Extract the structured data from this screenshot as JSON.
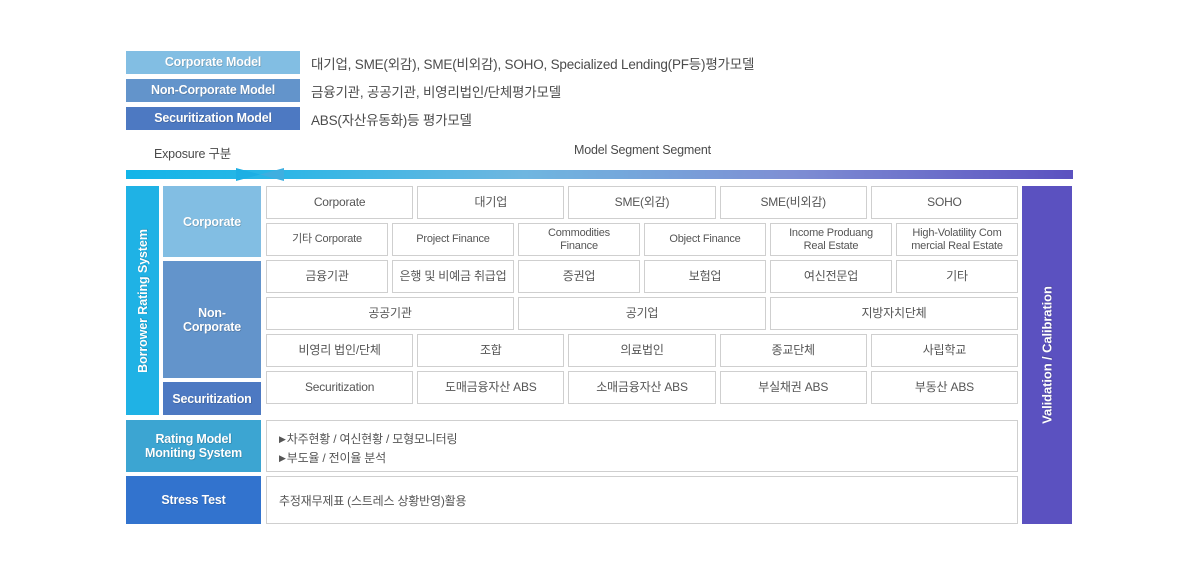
{
  "legend": {
    "rows": [
      {
        "label": "Corporate Model",
        "color": "#82BEE3",
        "desc": "대기업, SME(외감), SME(비외감), SOHO, Specialized Lending(PF등)평가모델"
      },
      {
        "label": "Non-Corporate Model",
        "color": "#6394CB",
        "desc": "금융기관, 공공기관, 비영리법인/단체평가모델"
      },
      {
        "label": "Securitization Model",
        "color": "#4D79C2",
        "desc": "ABS(자산유동화)등 평가모델"
      }
    ]
  },
  "axis": {
    "left_label": "Exposure 구분",
    "right_label": "Model Segment Segment",
    "gradient_start": "#12B5E8",
    "gradient_end": "#5B51C0"
  },
  "rails": {
    "borrower_rating_system": "Borrower Rating System",
    "validation_calibration": "Validation / Calibration"
  },
  "categories": {
    "corporate": "Corporate",
    "non_corporate": "Non-\nCorporate",
    "non_corporate_line1": "Non-",
    "non_corporate_line2": "Corporate",
    "securitization": "Securitization"
  },
  "side_blocks": {
    "rating_line1": "Rating Model",
    "rating_line2": "Moniting System",
    "stress": "Stress Test"
  },
  "grid": {
    "row1": [
      "Corporate",
      "대기업",
      "SME(외감)",
      "SME(비외감)",
      "SOHO"
    ],
    "row2": [
      "기타 Corporate",
      "Project Finance",
      "Commodities\nFinance",
      "Object Finance",
      "Income Produang\nReal Estate",
      "High-Volatility Com\nmercial Real Estate"
    ],
    "row2_cells": [
      {
        "l1": "기타 Corporate",
        "l2": ""
      },
      {
        "l1": "Project Finance",
        "l2": ""
      },
      {
        "l1": "Commodities",
        "l2": "Finance"
      },
      {
        "l1": "Object Finance",
        "l2": ""
      },
      {
        "l1": "Income Produang",
        "l2": "Real Estate"
      },
      {
        "l1": "High-Volatility Com",
        "l2": "mercial Real Estate"
      }
    ],
    "row3": [
      "금융기관",
      "은행 및 비예금 취급업",
      "증권업",
      "보험업",
      "여신전문업",
      "기타"
    ],
    "row4": [
      "공공기관",
      "공기업",
      "지방자치단체"
    ],
    "row5": [
      "비영리 법인/단체",
      "조합",
      "의료법인",
      "종교단체",
      "사립학교"
    ],
    "row6": [
      "Securitization",
      "도매금융자산 ABS",
      "소매금융자산 ABS",
      "부실채권 ABS",
      "부동산 ABS"
    ]
  },
  "panels": {
    "rating_line1": "차주현황 / 여신현황 / 모형모니터링",
    "rating_line2": "부도율 / 전이율 분석",
    "rating_bullet": "▶",
    "stress_text": "추정재무제표 (스트레스 상황반영)활용"
  }
}
